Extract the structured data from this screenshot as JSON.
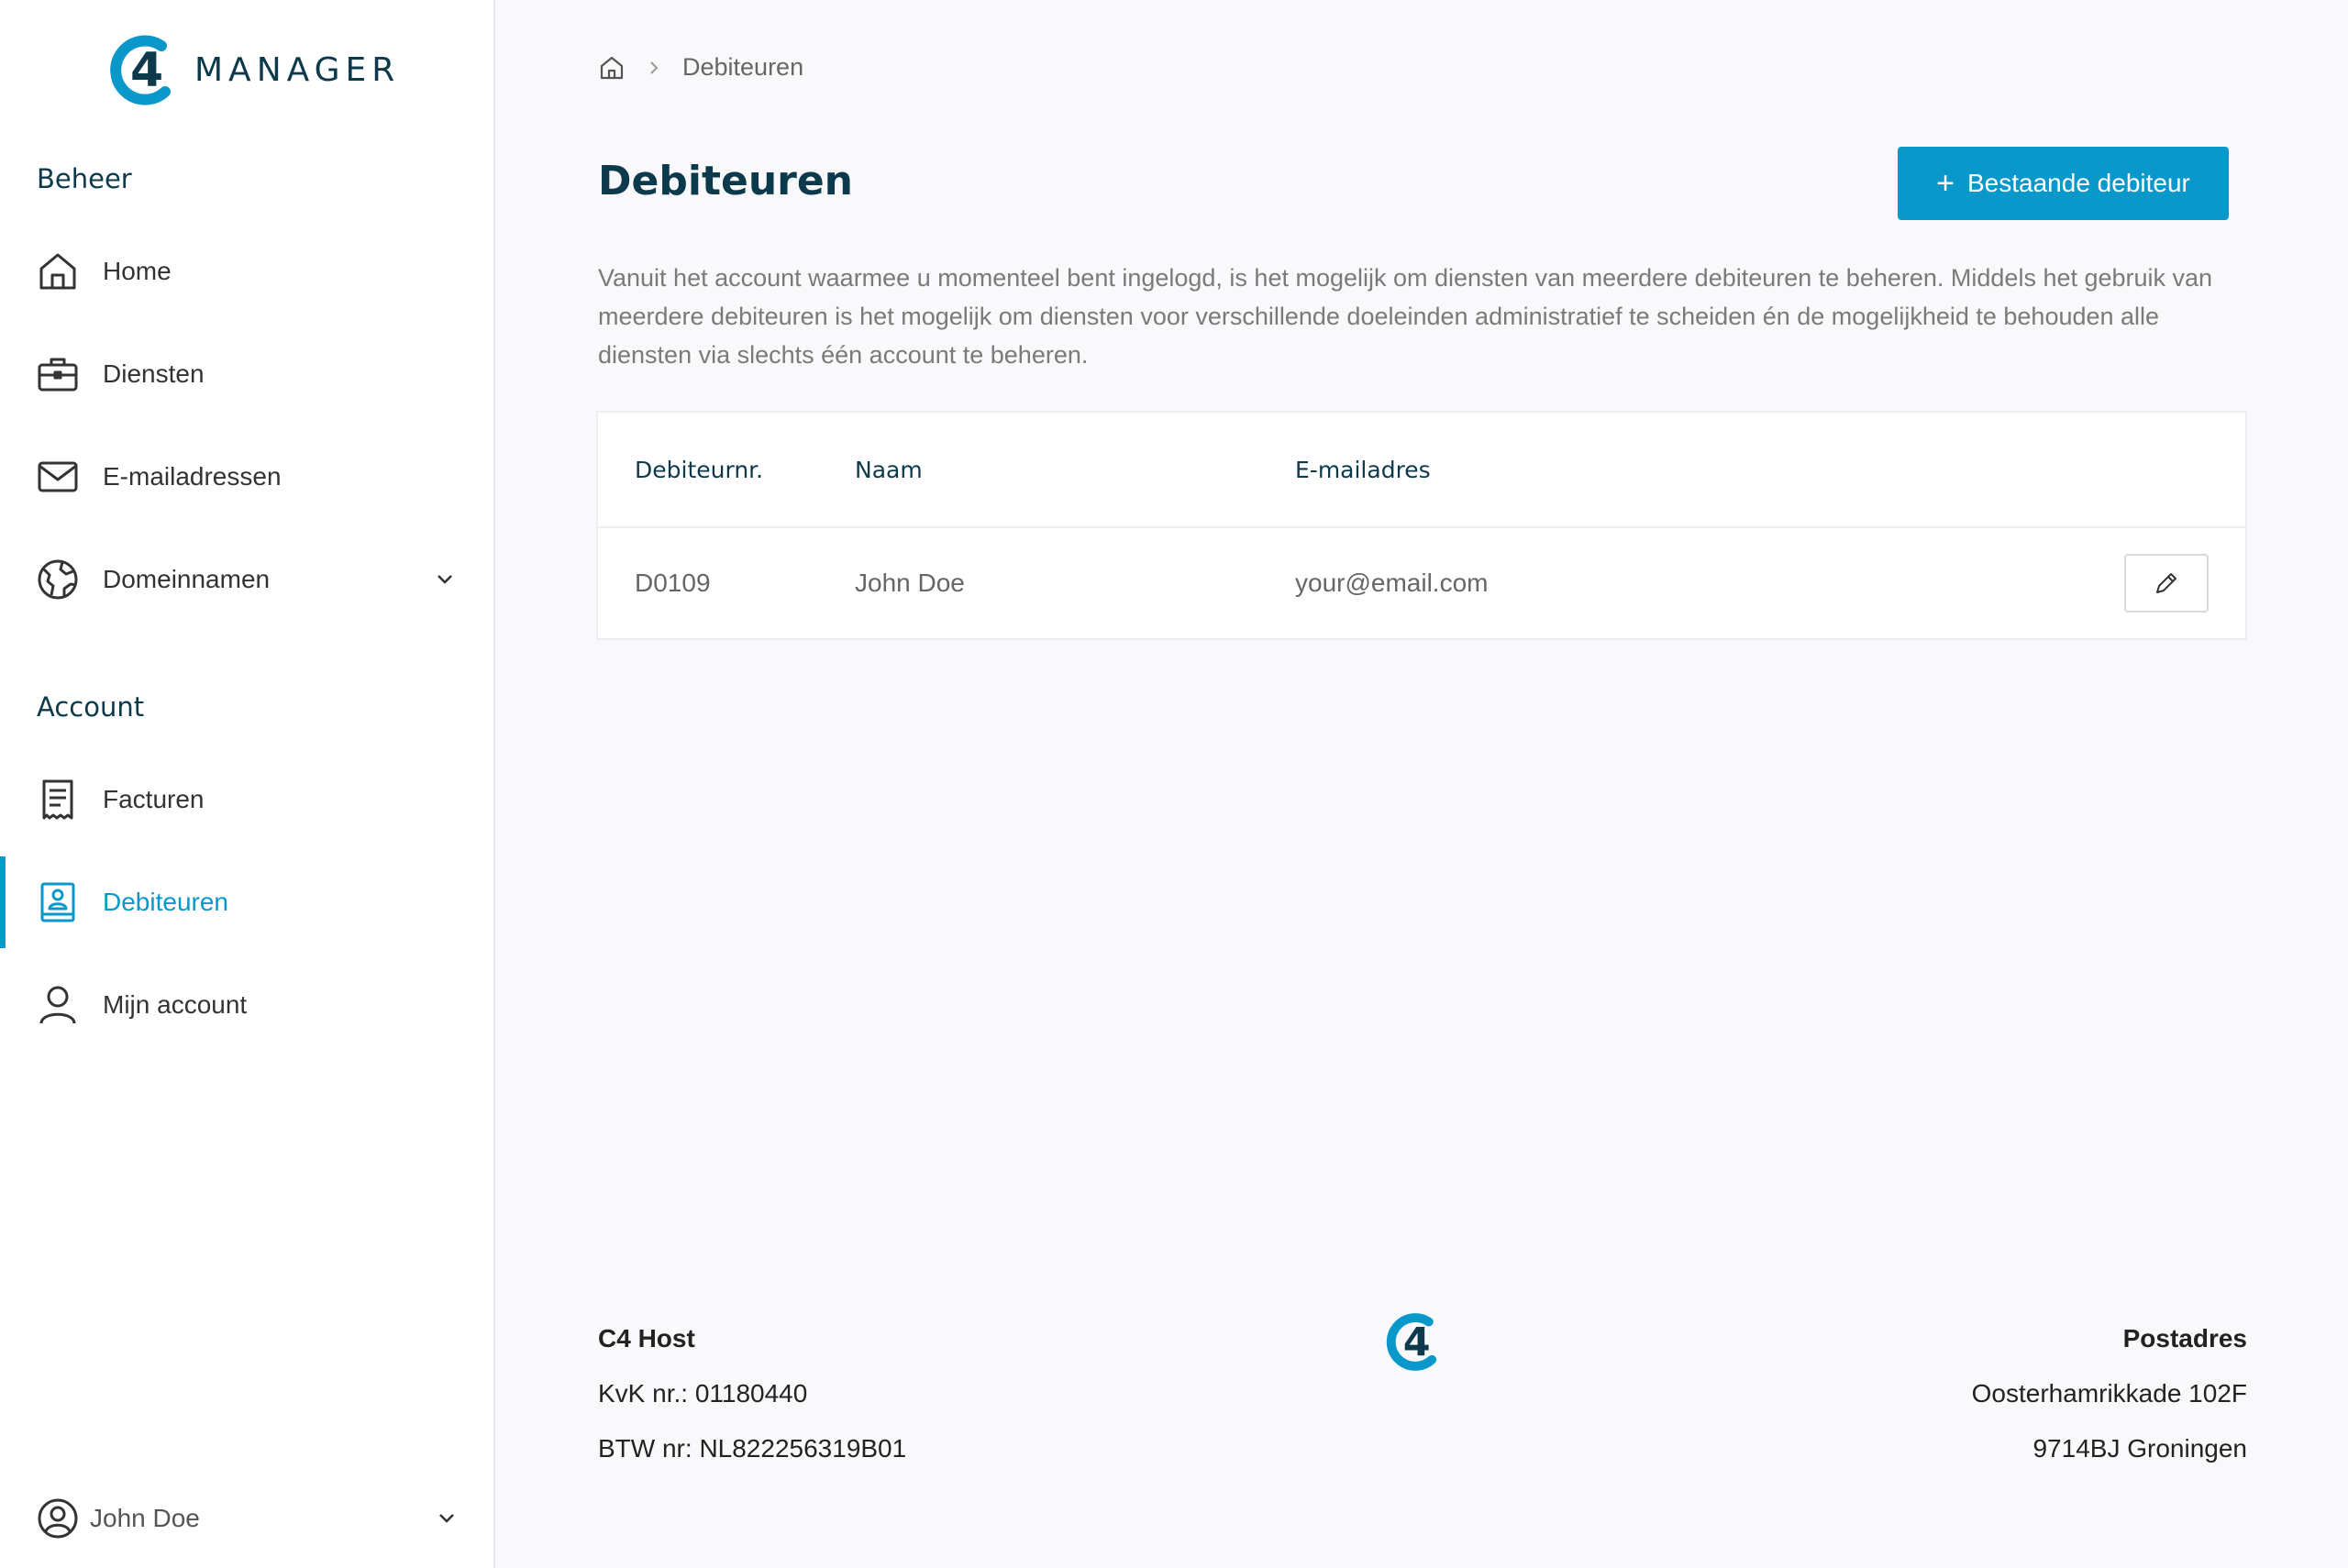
{
  "brand": {
    "logo_mark": "4",
    "name": "MANAGER",
    "primary_color": "#0a98cb",
    "dark_color": "#0c3a4c"
  },
  "sidebar": {
    "sections": [
      {
        "title": "Beheer"
      },
      {
        "title": "Account"
      }
    ],
    "items": [
      {
        "label": "Home",
        "icon": "home-icon",
        "active": false
      },
      {
        "label": "Diensten",
        "icon": "briefcase-icon",
        "active": false
      },
      {
        "label": "E-mailadressen",
        "icon": "mail-icon",
        "active": false
      },
      {
        "label": "Domeinnamen",
        "icon": "globe-icon",
        "active": false,
        "expandable": true
      },
      {
        "label": "Facturen",
        "icon": "receipt-icon",
        "active": false
      },
      {
        "label": "Debiteuren",
        "icon": "contact-book-icon",
        "active": true
      },
      {
        "label": "Mijn account",
        "icon": "user-icon",
        "active": false
      }
    ],
    "user": {
      "name": "John Doe"
    }
  },
  "breadcrumb": {
    "home_icon": "home-icon",
    "current": "Debiteuren"
  },
  "page": {
    "title": "Debiteuren",
    "add_button": {
      "icon": "+",
      "label": "Bestaande debiteur"
    },
    "intro": "Vanuit het account waarmee u momenteel bent ingelogd, is het mogelijk om diensten van meerdere debiteuren te beheren. Middels het gebruik van meerdere debiteuren is het mogelijk om diensten voor verschillende doeleinden administratief te scheiden én de mogelijkheid te behouden alle diensten via slechts één account te beheren."
  },
  "table": {
    "columns": [
      "Debiteurnr.",
      "Naam",
      "E-mailadres"
    ],
    "rows": [
      {
        "number": "D0109",
        "name": "John Doe",
        "email": "your@email.com"
      }
    ]
  },
  "footer": {
    "company": "C4 Host",
    "kvk": "KvK nr.: 01180440",
    "btw": "BTW nr: NL822256319B01",
    "postal_title": "Postadres",
    "street": "Oosterhamrikkade 102F",
    "city": "9714BJ Groningen"
  }
}
